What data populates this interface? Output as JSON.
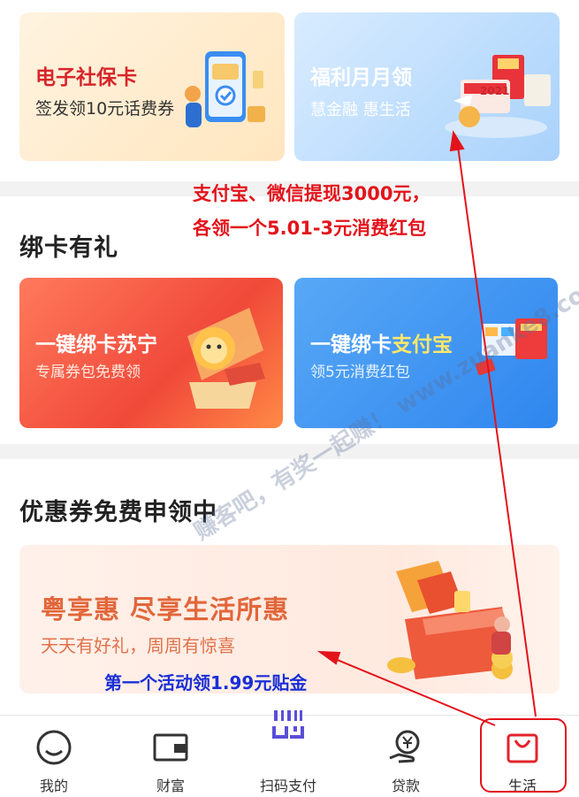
{
  "cards": {
    "social_security": {
      "title": "电子社保卡",
      "subtitle": "签发领10元话费券"
    },
    "welfare": {
      "title": "福利月月领",
      "subtitle": "慧金融  惠生活",
      "badge": "2021"
    },
    "bind_suning": {
      "title": "一键绑卡苏宁",
      "subtitle": "专属券包免费领"
    },
    "bind_alipay": {
      "title_prefix": "一键绑卡",
      "title_highlight": "支付宝",
      "subtitle": "领5元消费红包"
    },
    "yue_xiang_hui": {
      "title": "粤享惠  尽享生活所惠",
      "subtitle": "天天有好礼，周周有惊喜"
    }
  },
  "sections": {
    "bind_card": {
      "title": "绑卡有礼"
    },
    "coupons": {
      "title": "优惠券免费申领中"
    }
  },
  "annotations": {
    "red_line_1": "支付宝、微信提现3000元，",
    "red_line_2": "各领一个5.01-3元消费红包",
    "blue_line": "第一个活动领1.99元贴金"
  },
  "watermark": "赚客吧，有奖一起赚！ www.zuanke8.com",
  "tabbar": {
    "items": [
      {
        "id": "mine",
        "label": "我的",
        "icon": "face-icon"
      },
      {
        "id": "wealth",
        "label": "财富",
        "icon": "wallet-icon"
      },
      {
        "id": "scan",
        "label": "扫码支付",
        "icon": "scan-icon"
      },
      {
        "id": "loan",
        "label": "贷款",
        "icon": "yuan-hand-icon"
      },
      {
        "id": "life",
        "label": "生活",
        "icon": "shopping-bag-icon"
      }
    ]
  },
  "colors": {
    "annotation_red": "#e3131b",
    "annotation_blue": "#1a2fd6",
    "brand_red": "#d7262b"
  }
}
